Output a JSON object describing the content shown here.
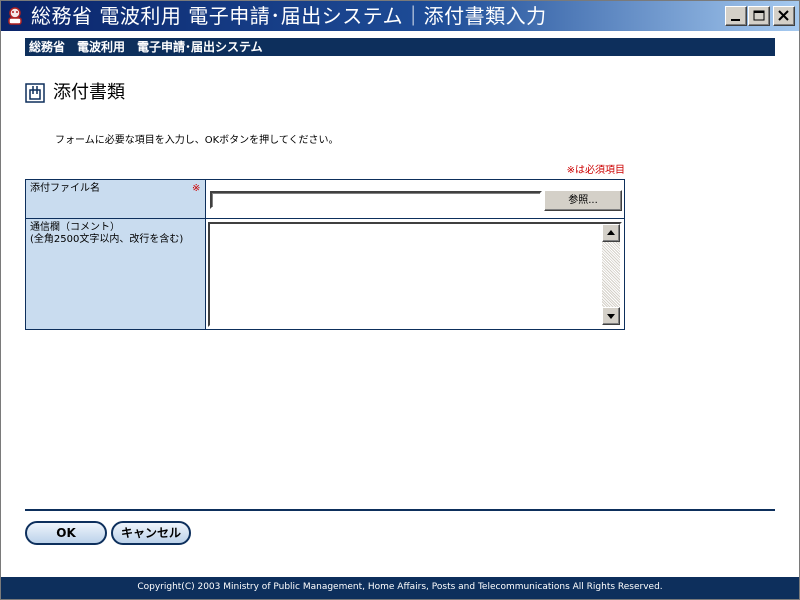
{
  "window": {
    "title": "総務省 電波利用 電子申請･届出システム｜添付書類入力",
    "controls": {
      "minimize": "_",
      "maximize": "□",
      "close": "X"
    }
  },
  "header": {
    "system_name": "総務省　電波利用　電子申請･届出システム"
  },
  "page": {
    "title": "添付書類",
    "instruction": "フォームに必要な項目を入力し、OKボタンを押してください。",
    "required_legend": "※は必須項目"
  },
  "form": {
    "attachment": {
      "label": "添付ファイル名",
      "required_mark": "※",
      "value": "",
      "browse_label": "参照..."
    },
    "comment": {
      "label_line1": "通信欄（コメント）",
      "label_line2": "(全角2500文字以内、改行を含む)",
      "value": ""
    }
  },
  "actions": {
    "ok_label": "OK",
    "cancel_label": "キャンセル"
  },
  "footer": {
    "copyright": "Copyright(C) 2003 Ministry of Public Management, Home Affairs, Posts and Telecommunications All Rights Reserved."
  },
  "colors": {
    "navy": "#0d2f5c",
    "label_bg": "#c9dcef",
    "required_red": "#cc0000"
  }
}
